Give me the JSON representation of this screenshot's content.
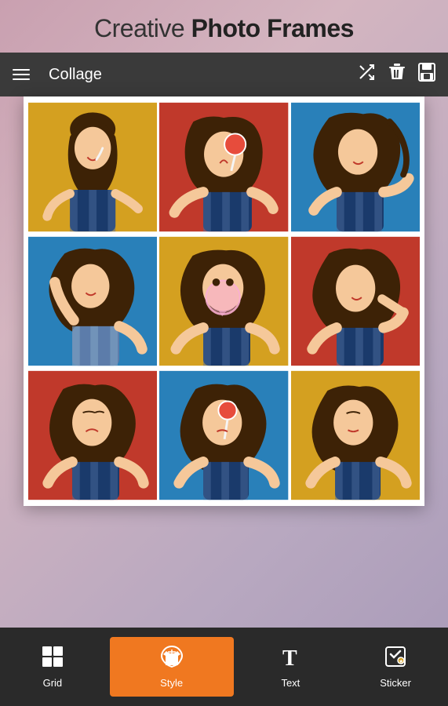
{
  "header": {
    "title_plain": "Creative ",
    "title_bold": "Photo Frames"
  },
  "toolbar": {
    "title": "Collage",
    "shuffle_icon": "⇄",
    "delete_icon": "🗑",
    "save_icon": "💾"
  },
  "collage": {
    "rows": 3,
    "cols": 3,
    "cells": [
      {
        "bg": "#d4a017",
        "label": "photo-1"
      },
      {
        "bg": "#c0392b",
        "label": "photo-2"
      },
      {
        "bg": "#2980b9",
        "label": "photo-3"
      },
      {
        "bg": "#2980b9",
        "label": "photo-4"
      },
      {
        "bg": "#d4a017",
        "label": "photo-5"
      },
      {
        "bg": "#c0392b",
        "label": "photo-6"
      },
      {
        "bg": "#c0392b",
        "label": "photo-7"
      },
      {
        "bg": "#2980b9",
        "label": "photo-8"
      },
      {
        "bg": "#d4a017",
        "label": "photo-9"
      }
    ]
  },
  "bottom_nav": {
    "items": [
      {
        "id": "grid",
        "label": "Grid",
        "active": false
      },
      {
        "id": "style",
        "label": "Style",
        "active": true
      },
      {
        "id": "text",
        "label": "Text",
        "active": false
      },
      {
        "id": "sticker",
        "label": "Sticker",
        "active": false
      }
    ]
  }
}
